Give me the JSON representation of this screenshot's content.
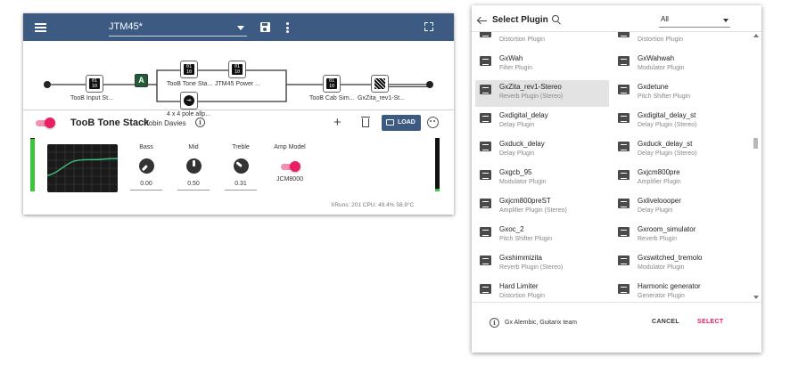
{
  "preset": {
    "name": "JTM45*"
  },
  "chain": {
    "nodes": [
      {
        "label": "TooB Input St..."
      },
      {
        "label": "TooB Tone Sta..."
      },
      {
        "label": "JTM45 Power ..."
      },
      {
        "label": "4 x 4 pole allp..."
      },
      {
        "label": "TooB Cab Sim..."
      },
      {
        "label": "GxZita_rev1-St..."
      }
    ],
    "split_label": "A"
  },
  "plugin": {
    "title": "TooB Tone Stack",
    "author": "Robin Davies",
    "load_label": "LOAD",
    "controls": [
      {
        "label": "Bass",
        "value": "0.00",
        "level": 0.0
      },
      {
        "label": "Mid",
        "value": "0.50",
        "level": 0.5
      },
      {
        "label": "Treble",
        "value": "0.31",
        "level": 0.31
      }
    ],
    "amp_model": {
      "label": "Amp Model",
      "value": "JCM8000"
    },
    "status": "XRuns: 201  CPU: 49.4%  58.9°C",
    "output_level": 0.05
  },
  "dialog": {
    "title": "Select Plugin",
    "filter": "All",
    "plugins": [
      {
        "name": "",
        "type": "Distortion Plugin"
      },
      {
        "name": "",
        "type": "Distortion Plugin"
      },
      {
        "name": "GxWah",
        "type": "Filter Plugin"
      },
      {
        "name": "GxWahwah",
        "type": "Modulator Plugin"
      },
      {
        "name": "GxZita_rev1-Stereo",
        "type": "Reverb Plugin (Stereo)",
        "selected": true
      },
      {
        "name": "Gxdetune",
        "type": "Pitch Shifter Plugin"
      },
      {
        "name": "Gxdigital_delay",
        "type": "Delay Plugin"
      },
      {
        "name": "Gxdigital_delay_st",
        "type": "Delay Plugin (Stereo)"
      },
      {
        "name": "Gxduck_delay",
        "type": "Delay Plugin"
      },
      {
        "name": "Gxduck_delay_st",
        "type": "Delay Plugin (Stereo)"
      },
      {
        "name": "Gxgcb_95",
        "type": "Modulator Plugin"
      },
      {
        "name": "Gxjcm800pre",
        "type": "Amplifier Plugin"
      },
      {
        "name": "Gxjcm800preST",
        "type": "Amplifier Plugin (Stereo)"
      },
      {
        "name": "Gxliveloooper",
        "type": "Delay Plugin"
      },
      {
        "name": "Gxoc_2",
        "type": "Pitch Shifter Plugin"
      },
      {
        "name": "Gxroom_simulator",
        "type": "Reverb Plugin"
      },
      {
        "name": "Gxshimmizita",
        "type": "Reverb Plugin (Stereo)"
      },
      {
        "name": "Gxswitched_tremolo",
        "type": "Modulator Plugin"
      },
      {
        "name": "Hard Limiter",
        "type": "Distortion Plugin"
      },
      {
        "name": "Harmonic generator",
        "type": "Generator Plugin"
      }
    ],
    "credit": "Gx Alembic, Guitarix team",
    "cancel_label": "CANCEL",
    "select_label": "SELECT"
  }
}
